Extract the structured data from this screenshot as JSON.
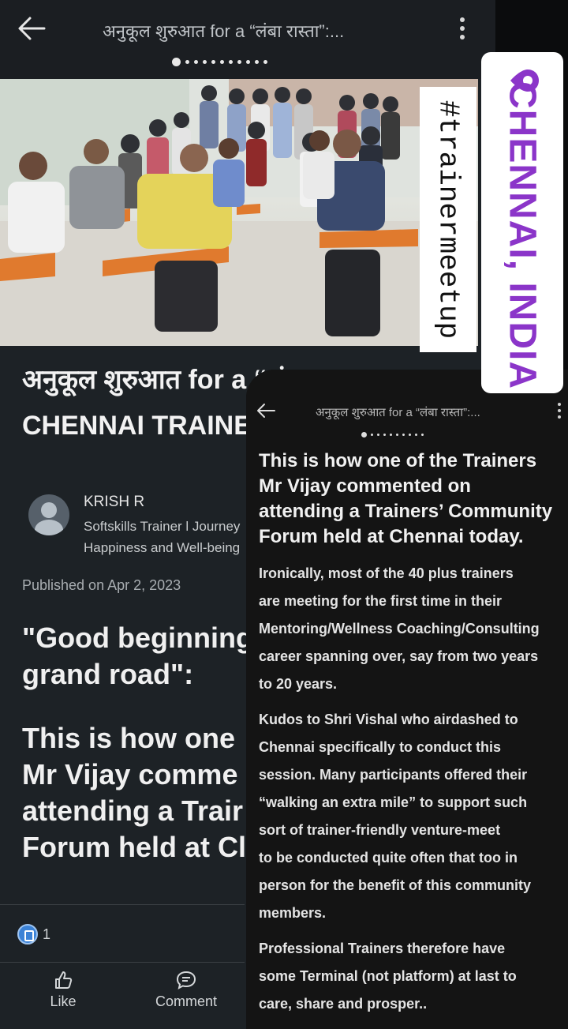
{
  "article": {
    "topbar_title": "अनुकूल  शुरुआत for a “लंबा रास्ता”:...",
    "hero_line1": "अनुकूल  शुरुआत for a “लंबा रास्ता”:",
    "hero_line2": "CHENNAI TRAINERS",
    "author_name": "KRISH R",
    "author_sub_line1": "Softskills Trainer l Journey",
    "author_sub_line2": "Happiness and Well-being",
    "published": "Published on Apr 2, 2023",
    "quote_line1": "\"Good beginning",
    "quote_line2": "grand road\":",
    "body_line1": "This is how one",
    "body_line2": "Mr Vijay comme",
    "body_line3": "attending a Trair",
    "body_line4": "Forum held at Cl",
    "reaction_count": "1",
    "like_label": "Like",
    "comment_label": "Comment"
  },
  "overlay": {
    "title": "अनुकूल  शुरुआत for a “लंबा रास्ता”:...",
    "lead_line1": "This is how one of the Trainers",
    "lead_line2": "Mr Vijay commented on",
    "lead_line3": "attending a Trainers’ Community",
    "lead_line4": "Forum held at Chennai today.",
    "para1": [
      "Ironically, most of the 40 plus trainers",
      "are meeting for the first time in their",
      "Mentoring/Wellness Coaching/Consulting",
      "career spanning over,  say from two years",
      "to 20 years."
    ],
    "para2": [
      "Kudos to Shri Vishal who airdashed to",
      "Chennai specifically to conduct this",
      "session. Many participants offered their",
      "“walking an extra mile” to support such",
      "sort of trainer-friendly  venture-meet",
      "to be conducted quite often that too in",
      "person for the benefit of this community",
      "members."
    ],
    "para3": [
      "Professional Trainers  therefore have",
      "some Terminal (not platform) at last to",
      "care, share and prosper.."
    ]
  },
  "stickers": {
    "hashtag": "#trainermeetup",
    "location": "CHENNAI, INDIA",
    "location_color": "#8b35c9"
  },
  "icons": {
    "back": "back-arrow-icon",
    "menu": "kebab-menu-icon",
    "like": "thumbs-up-icon",
    "comment": "comment-bubble-icon",
    "reaction": "like-reaction-icon",
    "location": "location-pin-icon"
  }
}
